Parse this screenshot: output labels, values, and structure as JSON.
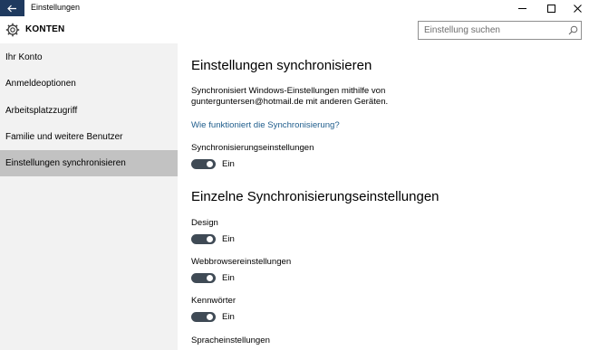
{
  "window": {
    "title": "Einstellungen",
    "minimize_icon": "minimize-icon",
    "maximize_icon": "maximize-icon",
    "close_icon": "close-icon",
    "back_icon": "back-arrow-icon",
    "accent": "#1f3a5f"
  },
  "header": {
    "section_title": "KONTEN",
    "icon": "gear-icon",
    "search_placeholder": "Einstellung suchen"
  },
  "sidebar": {
    "items": [
      {
        "label": "Ihr Konto",
        "active": false
      },
      {
        "label": "Anmeldeoptionen",
        "active": false
      },
      {
        "label": "Arbeitsplatzzugriff",
        "active": false
      },
      {
        "label": "Familie und weitere Benutzer",
        "active": false
      },
      {
        "label": "Einstellungen synchronisieren",
        "active": true
      }
    ]
  },
  "main": {
    "heading": "Einstellungen synchronisieren",
    "description_line1": "Synchronisiert Windows-Einstellungen mithilfe von",
    "description_line2": "gunterguntersen@hotmail.de mit anderen Geräten.",
    "help_link": "Wie funktioniert die Synchronisierung?",
    "master_toggle": {
      "label": "Synchronisierungseinstellungen",
      "state": "Ein"
    },
    "subheading": "Einzelne Synchronisierungseinstellungen",
    "settings": [
      {
        "label": "Design",
        "state": "Ein"
      },
      {
        "label": "Webbrowsereinstellungen",
        "state": "Ein"
      },
      {
        "label": "Kennwörter",
        "state": "Ein"
      },
      {
        "label": "Spracheinstellungen"
      }
    ]
  },
  "colors": {
    "toggle_on": "#3f4a55",
    "link": "#1f5d8c",
    "sidebar_bg": "#f2f2f2",
    "sidebar_active": "#c2c2c2"
  }
}
